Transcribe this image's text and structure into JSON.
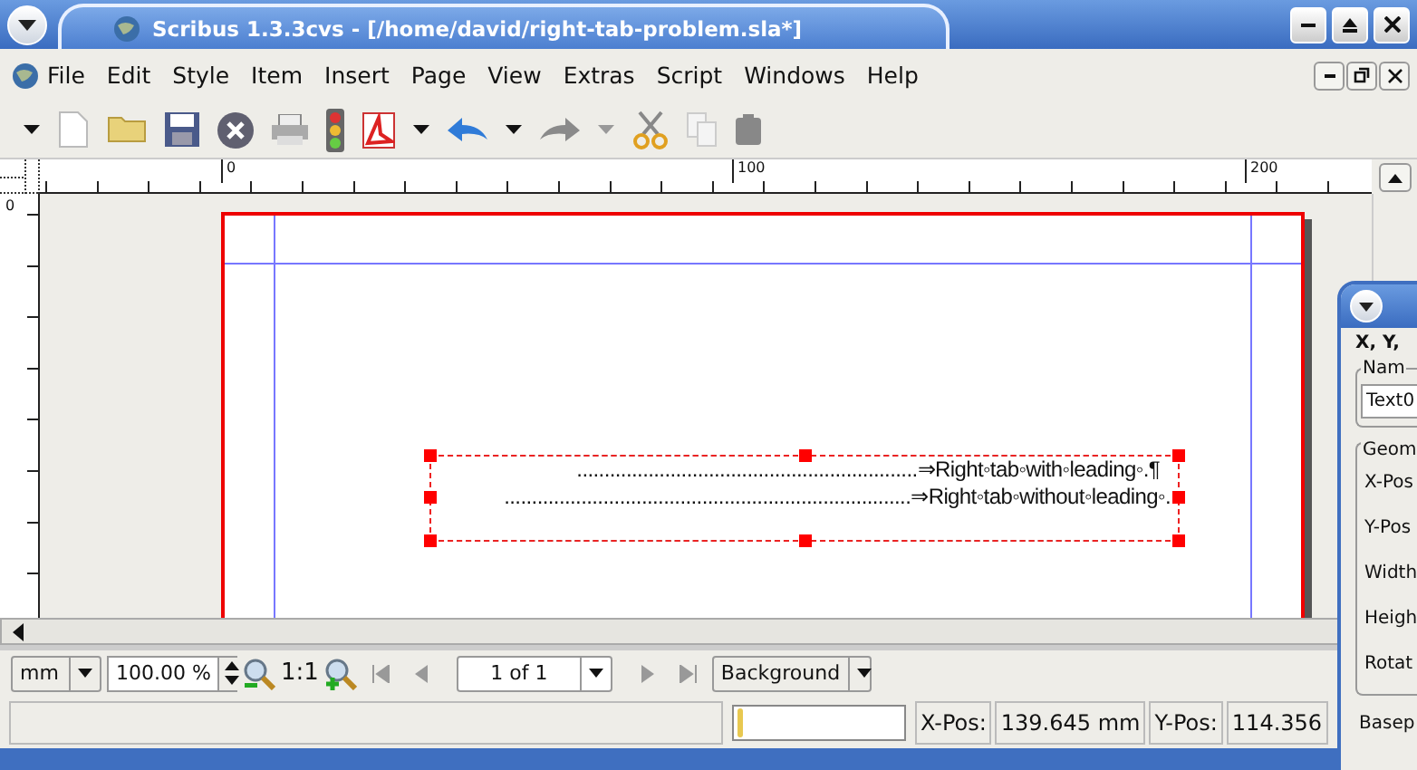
{
  "window": {
    "title": "Scribus 1.3.3cvs - [/home/david/right-tab-problem.sla*]"
  },
  "menu": [
    {
      "label": "File"
    },
    {
      "label": "Edit"
    },
    {
      "label": "Style"
    },
    {
      "label": "Item"
    },
    {
      "label": "Insert"
    },
    {
      "label": "Page"
    },
    {
      "label": "View"
    },
    {
      "label": "Extras"
    },
    {
      "label": "Script"
    },
    {
      "label": "Windows"
    },
    {
      "label": "Help"
    }
  ],
  "ruler": {
    "horizontal_labels": [
      "0",
      "100",
      "200"
    ],
    "vertical_labels": [
      "0"
    ]
  },
  "text_frame": {
    "lines": [
      {
        "text": "..............................................................⇒Right◦tab◦with◦leading◦.¶"
      },
      {
        "text": "..........................................................................⇒Right◦tab◦without◦leading◦."
      }
    ]
  },
  "view_bar": {
    "unit": "mm",
    "zoom": "100.00 %",
    "actual_size": "1:1",
    "page": "1 of 1",
    "layer": "Background"
  },
  "status_bar": {
    "progress": {
      "level": 0.03
    },
    "xpos_label": "X-Pos:",
    "xpos": "139.645 mm",
    "ypos_label": "Y-Pos:",
    "ypos": "114.356"
  },
  "properties_panel": {
    "tabs": "X, Y,",
    "name_group": "Nam",
    "name_value": "Text0",
    "geometry_group": "Geom",
    "fields": [
      "X-Pos",
      "Y-Pos",
      "Width",
      "Heigh",
      "Rotat"
    ],
    "baseline": "Basep"
  }
}
